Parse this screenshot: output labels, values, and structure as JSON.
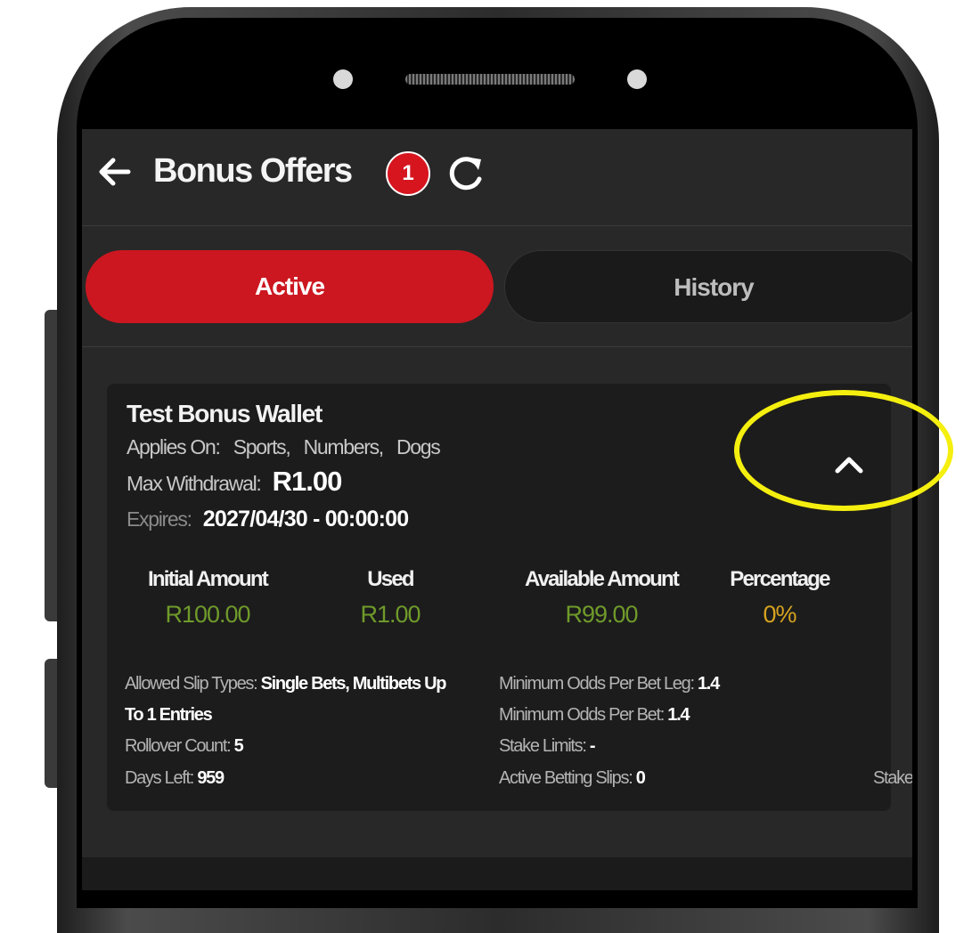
{
  "header": {
    "title": "Bonus Offers",
    "badge_count": "1"
  },
  "tabs": [
    {
      "label": "Active",
      "active": true
    },
    {
      "label": "History",
      "active": false
    }
  ],
  "bonus": {
    "title": "Test Bonus Wallet",
    "applies_label": "Applies On:",
    "applies_items": [
      "Sports,",
      "Numbers,",
      "Dogs"
    ],
    "max_withdrawal_label": "Max Withdrawal:",
    "max_withdrawal_value": "R1.00",
    "expires_label": "Expires:",
    "expires_value": "2027/04/30 - 00:00:00",
    "stats": [
      {
        "label": "Initial Amount",
        "value": "R100.00",
        "color": "#6f9a2a"
      },
      {
        "label": "Used",
        "value": "R1.00",
        "color": "#6f9a2a"
      },
      {
        "label": "Available Amount",
        "value": "R99.00",
        "color": "#6f9a2a"
      },
      {
        "label": "Percentage",
        "value": "0%",
        "color": "#d6a21f"
      }
    ],
    "details": {
      "allowed_slip_label": "Allowed Slip Types:",
      "allowed_slip_value": "Single Bets, Multibets Up",
      "allowed_slip_value_cont": "To 1 Entries",
      "rollover_label": "Rollover Count:",
      "rollover_value": "5",
      "days_left_label": "Days Left:",
      "days_left_value": "959",
      "min_odds_leg_label": "Minimum Odds Per Bet Leg:",
      "min_odds_leg_value": "1.4",
      "min_odds_bet_label": "Minimum Odds Per Bet:",
      "min_odds_bet_value": "1.4",
      "stake_limits_label": "Stake Limits:",
      "stake_limits_value": "-",
      "active_slips_label": "Active Betting Slips:",
      "active_slips_value": "0",
      "truncated_label": "Stake"
    }
  },
  "icons": {
    "back": "arrow-left-icon",
    "refresh": "refresh-icon",
    "collapse": "chevron-up-icon"
  },
  "colors": {
    "accent": "#cc1720",
    "screen_bg": "#282828",
    "card_bg": "#1c1c1c",
    "amount_green": "#6f9a2a",
    "percentage_yellow": "#d6a21f",
    "highlight": "#f5ef0f"
  }
}
